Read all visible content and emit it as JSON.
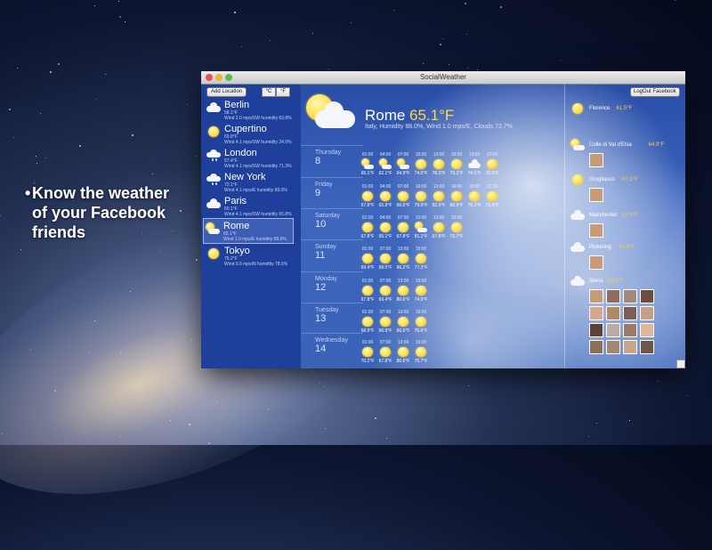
{
  "promo": {
    "line1": "Know the weather",
    "line2": "of your Facebook",
    "line3": "friends"
  },
  "window": {
    "title": "SocialWeather"
  },
  "toolbar": {
    "add_location": "Add Location",
    "celsius": "°C",
    "fahrenheit": "°F",
    "logout": "LogOut Facebook"
  },
  "sidebar": {
    "cities": [
      {
        "name": "Berlin",
        "temp": "58.1°F",
        "detail": "Wind 2.0 mps/SW humidity 63.8%",
        "icon": "cloud"
      },
      {
        "name": "Cupertino",
        "temp": "69.8°F",
        "detail": "Wind 4.1 mps/SW humidity 24.0%",
        "icon": "sun"
      },
      {
        "name": "London",
        "temp": "57.4°F",
        "detail": "Wind 4.1 mps/SW humidity 71.3%",
        "icon": "rain"
      },
      {
        "name": "New York",
        "temp": "72.1°F",
        "detail": "Wind 4.1 mps/E humidity 89.0%",
        "icon": "rain"
      },
      {
        "name": "Paris",
        "temp": "60.1°F",
        "detail": "Wind 4.1 mps/SW humidity 65.8%",
        "icon": "cloud"
      },
      {
        "name": "Rome",
        "temp": "65.1°F",
        "detail": "Wind 1.0 mps/E humidity 88.0%",
        "icon": "sun-cloud"
      },
      {
        "name": "Tokyo",
        "temp": "75.2°F",
        "detail": "Wind 0.9 mps/N humidity 78.0%",
        "icon": "sun"
      }
    ]
  },
  "main": {
    "city": "Rome",
    "temp": "65.1°F",
    "detail": "Italy, Humidity 88.0%, Wind 1.0 mps/E, Clouds 72.7%"
  },
  "forecast": [
    {
      "day": "Thursday",
      "num": "8",
      "slots": [
        {
          "time": "01:00",
          "temp": "65.1°F",
          "icon": "sun-cloud"
        },
        {
          "time": "04:00",
          "temp": "62.1°F",
          "icon": "sun-cloud"
        },
        {
          "time": "07:00",
          "temp": "64.9°F",
          "icon": "sun-cloud"
        },
        {
          "time": "10:00",
          "temp": "74.5°F",
          "icon": "sun"
        },
        {
          "time": "13:00",
          "temp": "78.3°F",
          "icon": "sun"
        },
        {
          "time": "16:00",
          "temp": "79.2°F",
          "icon": "sun"
        },
        {
          "time": "19:00",
          "temp": "74.1°F",
          "icon": "cloud"
        },
        {
          "time": "22:00",
          "temp": "70.9°F",
          "icon": "sun"
        }
      ]
    },
    {
      "day": "Friday",
      "num": "9",
      "slots": [
        {
          "time": "01:00",
          "temp": "67.8°F",
          "icon": "sun"
        },
        {
          "time": "04:00",
          "temp": "65.8°F",
          "icon": "sun"
        },
        {
          "time": "07:00",
          "temp": "66.6°F",
          "icon": "sun"
        },
        {
          "time": "10:00",
          "temp": "79.9°F",
          "icon": "sun"
        },
        {
          "time": "13:00",
          "temp": "82.9°F",
          "icon": "sun"
        },
        {
          "time": "16:00",
          "temp": "82.9°F",
          "icon": "sun"
        },
        {
          "time": "19:00",
          "temp": "76.1°F",
          "icon": "sun"
        },
        {
          "time": "22:00",
          "temp": "72.9°F",
          "icon": "sun"
        }
      ]
    },
    {
      "day": "Saturday",
      "num": "10",
      "slots": [
        {
          "time": "01:00",
          "temp": "67.8°F",
          "icon": "sun"
        },
        {
          "time": "04:00",
          "temp": "65.1°F",
          "icon": "sun"
        },
        {
          "time": "07:00",
          "temp": "67.8°F",
          "icon": "sun"
        },
        {
          "time": "10:00",
          "temp": "81.1°F",
          "icon": "sun-cloud"
        },
        {
          "time": "13:00",
          "temp": "67.8°F",
          "icon": "sun"
        },
        {
          "time": "16:00",
          "temp": "75.7°F",
          "icon": "sun"
        }
      ]
    },
    {
      "day": "Sunday",
      "num": "11",
      "slots": [
        {
          "time": "01:00",
          "temp": "69.4°F",
          "icon": "sun"
        },
        {
          "time": "07:00",
          "temp": "68.0°F",
          "icon": "sun"
        },
        {
          "time": "13:00",
          "temp": "86.2°F",
          "icon": "sun"
        },
        {
          "time": "19:00",
          "temp": "77.3°F",
          "icon": "sun"
        }
      ]
    },
    {
      "day": "Monday",
      "num": "12",
      "slots": [
        {
          "time": "01:00",
          "temp": "67.8°F",
          "icon": "sun"
        },
        {
          "time": "07:00",
          "temp": "69.4°F",
          "icon": "sun"
        },
        {
          "time": "13:00",
          "temp": "80.6°F",
          "icon": "sun"
        },
        {
          "time": "19:00",
          "temp": "74.5°F",
          "icon": "sun"
        }
      ]
    },
    {
      "day": "Tuesday",
      "num": "13",
      "slots": [
        {
          "time": "01:00",
          "temp": "68.9°F",
          "icon": "sun"
        },
        {
          "time": "07:00",
          "temp": "66.9°F",
          "icon": "sun"
        },
        {
          "time": "13:00",
          "temp": "80.6°F",
          "icon": "sun"
        },
        {
          "time": "19:00",
          "temp": "76.6°F",
          "icon": "sun"
        }
      ]
    },
    {
      "day": "Wednesday",
      "num": "14",
      "slots": [
        {
          "time": "01:00",
          "temp": "70.2°F",
          "icon": "sun"
        },
        {
          "time": "07:00",
          "temp": "67.8°F",
          "icon": "sun"
        },
        {
          "time": "13:00",
          "temp": "80.6°F",
          "icon": "sun"
        },
        {
          "time": "19:00",
          "temp": "75.7°F",
          "icon": "sun"
        }
      ]
    }
  ],
  "friends": [
    {
      "city": "Florence",
      "temp": "61.5°F",
      "icon": "sun",
      "avatars": 0
    },
    {
      "city": "Colle di Val d'Elsa",
      "temp": "64.9°F",
      "icon": "sun-cloud",
      "avatars": 1
    },
    {
      "city": "Grugliasco",
      "temp": "67.3°F",
      "icon": "sun",
      "avatars": 1
    },
    {
      "city": "Manchester",
      "temp": "52.9°F",
      "icon": "cloud",
      "avatars": 1
    },
    {
      "city": "Pickering",
      "temp": "64.9°F",
      "icon": "cloud",
      "avatars": 1
    },
    {
      "city": "Siena",
      "temp": "64.8°F",
      "icon": "cloud",
      "avatars": 16
    }
  ]
}
